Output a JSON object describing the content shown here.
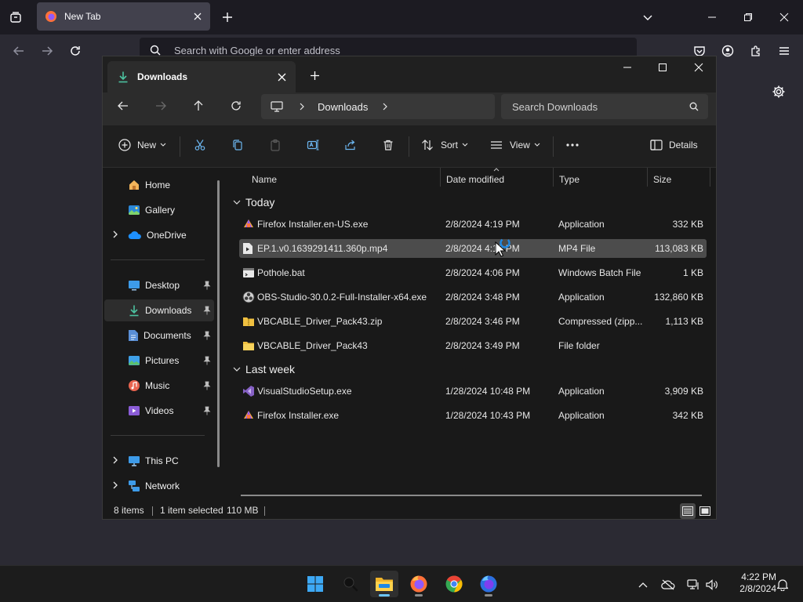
{
  "browser": {
    "tab_title": "New Tab",
    "url_placeholder": "Search with Google or enter address"
  },
  "explorer": {
    "tab_title": "Downloads",
    "breadcrumb": [
      "Downloads"
    ],
    "search_placeholder": "Search Downloads",
    "commands": {
      "new": "New",
      "sort": "Sort",
      "view": "View",
      "details": "Details"
    },
    "sidebar": {
      "top": [
        {
          "label": "Home"
        },
        {
          "label": "Gallery"
        },
        {
          "label": "OneDrive"
        }
      ],
      "pinned": [
        {
          "label": "Desktop"
        },
        {
          "label": "Downloads"
        },
        {
          "label": "Documents"
        },
        {
          "label": "Pictures"
        },
        {
          "label": "Music"
        },
        {
          "label": "Videos"
        }
      ],
      "bottom": [
        {
          "label": "This PC"
        },
        {
          "label": "Network"
        }
      ]
    },
    "columns": {
      "name": "Name",
      "date": "Date modified",
      "type": "Type",
      "size": "Size"
    },
    "groups": [
      {
        "title": "Today",
        "files": [
          {
            "name": "Firefox Installer.en-US.exe",
            "date": "2/8/2024 4:19 PM",
            "type": "Application",
            "size": "332 KB",
            "icon": "firefox-installer-icon"
          },
          {
            "name": "EP.1.v0.1639291411.360p.mp4",
            "date": "2/8/2024 4:10 PM",
            "type": "MP4 File",
            "size": "113,083 KB",
            "icon": "video-file-icon"
          },
          {
            "name": "Pothole.bat",
            "date": "2/8/2024 4:06 PM",
            "type": "Windows Batch File",
            "size": "1 KB",
            "icon": "batch-file-icon"
          },
          {
            "name": "OBS-Studio-30.0.2-Full-Installer-x64.exe",
            "date": "2/8/2024 3:48 PM",
            "type": "Application",
            "size": "132,860 KB",
            "icon": "obs-icon"
          },
          {
            "name": "VBCABLE_Driver_Pack43.zip",
            "date": "2/8/2024 3:46 PM",
            "type": "Compressed (zipp...",
            "size": "1,113 KB",
            "icon": "zip-folder-icon"
          },
          {
            "name": "VBCABLE_Driver_Pack43",
            "date": "2/8/2024 3:49 PM",
            "type": "File folder",
            "size": "",
            "icon": "folder-icon"
          }
        ]
      },
      {
        "title": "Last week",
        "files": [
          {
            "name": "VisualStudioSetup.exe",
            "date": "1/28/2024 10:48 PM",
            "type": "Application",
            "size": "3,909 KB",
            "icon": "visual-studio-icon"
          },
          {
            "name": "Firefox Installer.exe",
            "date": "1/28/2024 10:43 PM",
            "type": "Application",
            "size": "342 KB",
            "icon": "firefox-installer-icon"
          }
        ]
      }
    ],
    "status": {
      "count": "8 items",
      "selection": "1 item selected",
      "size": "110 MB"
    }
  },
  "taskbar": {
    "time": "4:22 PM",
    "date": "2/8/2024"
  },
  "colors": {
    "accent": "#60cdff",
    "folder": "#f0c040",
    "firefox_orange": "#ff7139"
  }
}
